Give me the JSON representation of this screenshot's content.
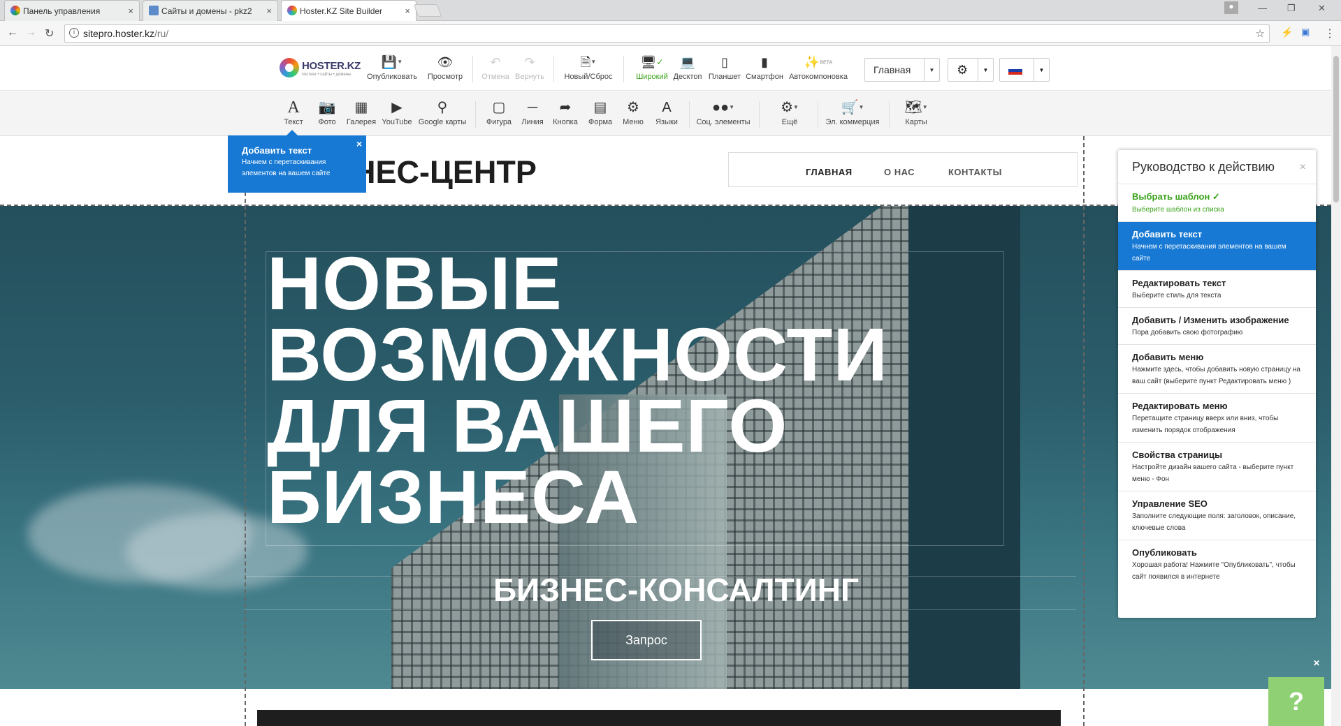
{
  "browser": {
    "tabs": [
      {
        "title": "Панель управления",
        "close": "×"
      },
      {
        "title": "Сайты и домены - pkz2",
        "close": "×"
      },
      {
        "title": "Hoster.KZ Site Builder",
        "close": "×"
      }
    ],
    "url_host": "sitepro.hoster.kz",
    "url_path": "/ru/"
  },
  "toolbar_top": {
    "logo_name": "HOSTER.KZ",
    "logo_tag": "хостинг • сайты • домены",
    "publish": "Опубликовать",
    "preview": "Просмотр",
    "undo": "Отмена",
    "redo": "Вернуть",
    "new_reset": "Новый/Сброс",
    "wide": "Широкий",
    "desktop": "Десктоп",
    "tablet": "Планшет",
    "smartphone": "Смартфон",
    "autolayout": "Автокомпоновка",
    "beta": "BETA",
    "page_select": "Главная"
  },
  "toolbar_elements": {
    "text": "Текст",
    "photo": "Фото",
    "gallery": "Галерея",
    "youtube": "YouTube",
    "google_maps": "Google карты",
    "shape": "Фигура",
    "line": "Линия",
    "button": "Кнопка",
    "form": "Форма",
    "menu": "Меню",
    "languages": "Языки",
    "social": "Соц. элементы",
    "more": "Ещё",
    "ecommerce": "Эл. коммерция",
    "maps": "Карты"
  },
  "site": {
    "title": "НЕС-ЦЕНТР",
    "menu": [
      "ГЛАВНАЯ",
      "О НАС",
      "КОНТАКТЫ"
    ],
    "hero_title": "НОВЫЕ ВОЗМОЖНОСТИ ДЛЯ ВАШЕГО БИЗНЕСА",
    "hero_subtitle": "БИЗНЕС-КОНСАЛТИНГ",
    "request_button": "Запрос"
  },
  "tooltip": {
    "title": "Добавить текст",
    "desc": "Начнем с перетаскивания элементов на вашем сайте",
    "close": "×"
  },
  "guide": {
    "title": "Руководство к действию",
    "close": "×",
    "items": [
      {
        "title": "Выбрать шаблон ✓",
        "desc": "Выберите шаблон из списка"
      },
      {
        "title": "Добавить текст",
        "desc": "Начнем с перетаскивания элементов на вашем сайте"
      },
      {
        "title": "Редактировать текст",
        "desc": "Выберите стиль для текста"
      },
      {
        "title": "Добавить / Изменить изображение",
        "desc": "Пора добавить свою фотографию"
      },
      {
        "title": "Добавить меню",
        "desc": "Нажмите здесь, чтобы добавить новую страницу на ваш сайт (выберите пункт Редактировать меню )"
      },
      {
        "title": "Редактировать меню",
        "desc": "Перетащите страницу вверх или вниз, чтобы изменить порядок отображения"
      },
      {
        "title": "Свойства страницы",
        "desc": "Настройте дизайн вашего сайта - выберите пункт меню - Фон"
      },
      {
        "title": "Управление SEO",
        "desc": "Заполните следующие поля: заголовок, описание, ключевые слова"
      },
      {
        "title": "Опубликовать",
        "desc": "Хорошая работа! Нажмите \"Опубликовать\", чтобы сайт появился в интернете"
      }
    ]
  },
  "help_button": "?",
  "colors": {
    "accent_blue": "#1779d4",
    "done_green": "#3aa21b"
  }
}
